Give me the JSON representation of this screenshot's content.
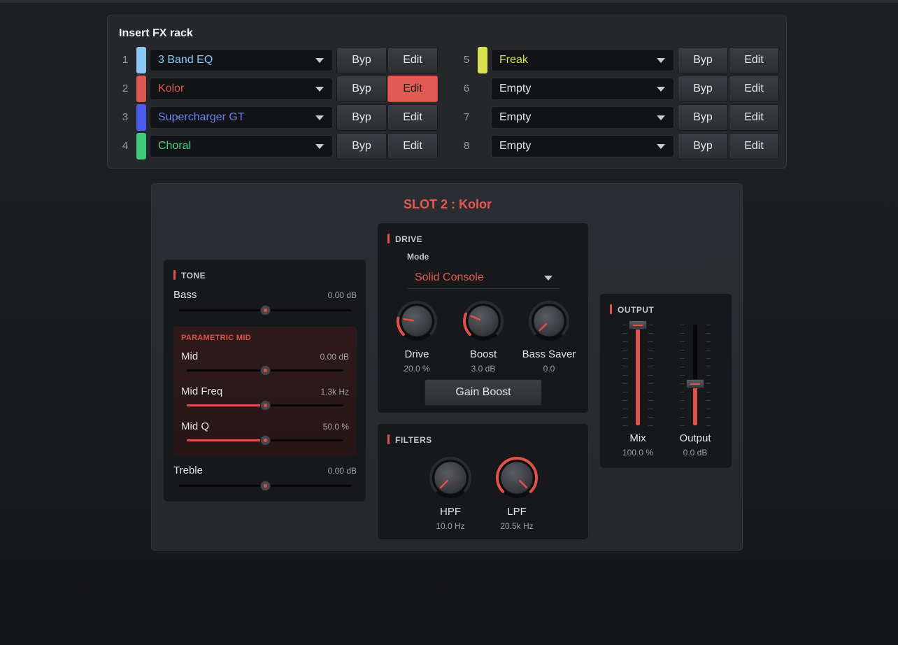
{
  "rack": {
    "title": "Insert FX rack",
    "slots": [
      {
        "num": "1",
        "name": "3 Band EQ",
        "color": "#8cc8f5",
        "text_color": "#8cc8f5",
        "byp": "Byp",
        "edit": "Edit",
        "edit_active": false
      },
      {
        "num": "2",
        "name": "Kolor",
        "color": "#e0574f",
        "text_color": "#e0574f",
        "byp": "Byp",
        "edit": "Edit",
        "edit_active": true
      },
      {
        "num": "3",
        "name": "Supercharger GT",
        "color": "#4b5cf0",
        "text_color": "#6f7ff5",
        "byp": "Byp",
        "edit": "Edit",
        "edit_active": false
      },
      {
        "num": "4",
        "name": "Choral",
        "color": "#3ecb7c",
        "text_color": "#4fd489",
        "byp": "Byp",
        "edit": "Edit",
        "edit_active": false
      },
      {
        "num": "5",
        "name": "Freak",
        "color": "#d7e24e",
        "text_color": "#d7e24e",
        "byp": "Byp",
        "edit": "Edit",
        "edit_active": false
      },
      {
        "num": "6",
        "name": "Empty",
        "color": "",
        "text_color": "#e2e4e7",
        "byp": "Byp",
        "edit": "Edit",
        "edit_active": false
      },
      {
        "num": "7",
        "name": "Empty",
        "color": "",
        "text_color": "#e2e4e7",
        "byp": "Byp",
        "edit": "Edit",
        "edit_active": false
      },
      {
        "num": "8",
        "name": "Empty",
        "color": "",
        "text_color": "#e2e4e7",
        "byp": "Byp",
        "edit": "Edit",
        "edit_active": false
      }
    ]
  },
  "editor": {
    "title": "SLOT 2 : Kolor",
    "tone": {
      "header": "TONE",
      "bass": {
        "label": "Bass",
        "value": "0.00 dB",
        "level": 0.5
      },
      "parametric": {
        "header": "PARAMETRIC MID",
        "mid": {
          "label": "Mid",
          "value": "0.00 dB",
          "level": 0.5
        },
        "mid_freq": {
          "label": "Mid Freq",
          "value": "1.3k Hz",
          "level": 0.5
        },
        "mid_q": {
          "label": "Mid Q",
          "value": "50.0 %",
          "level": 0.5
        }
      },
      "treble": {
        "label": "Treble",
        "value": "0.00 dB",
        "level": 0.5
      }
    },
    "drive": {
      "header": "DRIVE",
      "mode_label": "Mode",
      "mode_value": "Solid Console",
      "knobs": [
        {
          "label": "Drive",
          "value": "20.0 %",
          "level": 0.2
        },
        {
          "label": "Boost",
          "value": "3.0 dB",
          "level": 0.25
        },
        {
          "label": "Bass Saver",
          "value": "0.0",
          "level": 0.0
        }
      ],
      "gain_boost": "Gain Boost"
    },
    "filters": {
      "header": "FILTERS",
      "knobs": [
        {
          "label": "HPF",
          "value": "10.0 Hz",
          "level": 0.0
        },
        {
          "label": "LPF",
          "value": "20.5k Hz",
          "level": 1.0
        }
      ]
    },
    "output": {
      "header": "OUTPUT",
      "faders": [
        {
          "label": "Mix",
          "value": "100.0 %",
          "level": 1.0
        },
        {
          "label": "Output",
          "value": "0.0 dB",
          "level": 0.42
        }
      ]
    }
  },
  "colors": {
    "accent": "#e0514a"
  }
}
